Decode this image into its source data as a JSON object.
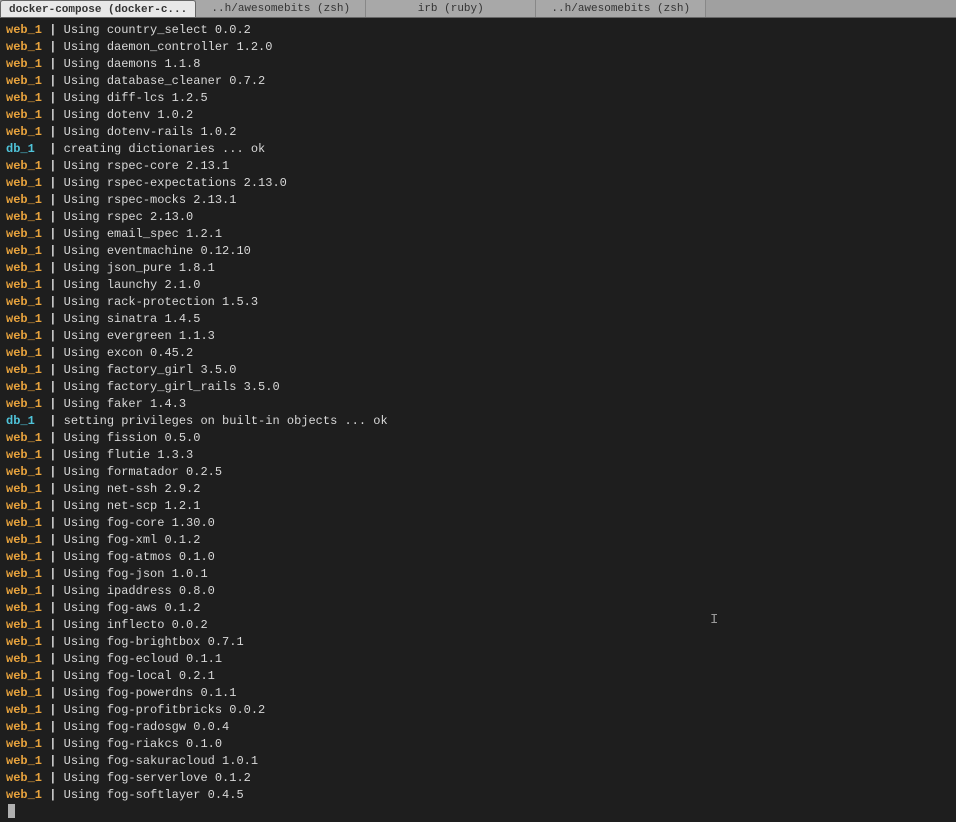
{
  "tabs": [
    {
      "label": "docker-compose (docker-c...",
      "active": true
    },
    {
      "label": "..h/awesomebits (zsh)",
      "active": false
    },
    {
      "label": "irb (ruby)",
      "active": false
    },
    {
      "label": "..h/awesomebits (zsh)",
      "active": false
    }
  ],
  "lines": [
    {
      "prefix": "web_1",
      "type": "web",
      "text": "Using country_select 0.0.2"
    },
    {
      "prefix": "web_1",
      "type": "web",
      "text": "Using daemon_controller 1.2.0"
    },
    {
      "prefix": "web_1",
      "type": "web",
      "text": "Using daemons 1.1.8"
    },
    {
      "prefix": "web_1",
      "type": "web",
      "text": "Using database_cleaner 0.7.2"
    },
    {
      "prefix": "web_1",
      "type": "web",
      "text": "Using diff-lcs 1.2.5"
    },
    {
      "prefix": "web_1",
      "type": "web",
      "text": "Using dotenv 1.0.2"
    },
    {
      "prefix": "web_1",
      "type": "web",
      "text": "Using dotenv-rails 1.0.2"
    },
    {
      "prefix": "db_1 ",
      "type": "db",
      "text": "creating dictionaries ... ok"
    },
    {
      "prefix": "web_1",
      "type": "web",
      "text": "Using rspec-core 2.13.1"
    },
    {
      "prefix": "web_1",
      "type": "web",
      "text": "Using rspec-expectations 2.13.0"
    },
    {
      "prefix": "web_1",
      "type": "web",
      "text": "Using rspec-mocks 2.13.1"
    },
    {
      "prefix": "web_1",
      "type": "web",
      "text": "Using rspec 2.13.0"
    },
    {
      "prefix": "web_1",
      "type": "web",
      "text": "Using email_spec 1.2.1"
    },
    {
      "prefix": "web_1",
      "type": "web",
      "text": "Using eventmachine 0.12.10"
    },
    {
      "prefix": "web_1",
      "type": "web",
      "text": "Using json_pure 1.8.1"
    },
    {
      "prefix": "web_1",
      "type": "web",
      "text": "Using launchy 2.1.0"
    },
    {
      "prefix": "web_1",
      "type": "web",
      "text": "Using rack-protection 1.5.3"
    },
    {
      "prefix": "web_1",
      "type": "web",
      "text": "Using sinatra 1.4.5"
    },
    {
      "prefix": "web_1",
      "type": "web",
      "text": "Using evergreen 1.1.3"
    },
    {
      "prefix": "web_1",
      "type": "web",
      "text": "Using excon 0.45.2"
    },
    {
      "prefix": "web_1",
      "type": "web",
      "text": "Using factory_girl 3.5.0"
    },
    {
      "prefix": "web_1",
      "type": "web",
      "text": "Using factory_girl_rails 3.5.0"
    },
    {
      "prefix": "web_1",
      "type": "web",
      "text": "Using faker 1.4.3"
    },
    {
      "prefix": "db_1 ",
      "type": "db",
      "text": "setting privileges on built-in objects ... ok"
    },
    {
      "prefix": "web_1",
      "type": "web",
      "text": "Using fission 0.5.0"
    },
    {
      "prefix": "web_1",
      "type": "web",
      "text": "Using flutie 1.3.3"
    },
    {
      "prefix": "web_1",
      "type": "web",
      "text": "Using formatador 0.2.5"
    },
    {
      "prefix": "web_1",
      "type": "web",
      "text": "Using net-ssh 2.9.2"
    },
    {
      "prefix": "web_1",
      "type": "web",
      "text": "Using net-scp 1.2.1"
    },
    {
      "prefix": "web_1",
      "type": "web",
      "text": "Using fog-core 1.30.0"
    },
    {
      "prefix": "web_1",
      "type": "web",
      "text": "Using fog-xml 0.1.2"
    },
    {
      "prefix": "web_1",
      "type": "web",
      "text": "Using fog-atmos 0.1.0"
    },
    {
      "prefix": "web_1",
      "type": "web",
      "text": "Using fog-json 1.0.1"
    },
    {
      "prefix": "web_1",
      "type": "web",
      "text": "Using ipaddress 0.8.0"
    },
    {
      "prefix": "web_1",
      "type": "web",
      "text": "Using fog-aws 0.1.2"
    },
    {
      "prefix": "web_1",
      "type": "web",
      "text": "Using inflecto 0.0.2"
    },
    {
      "prefix": "web_1",
      "type": "web",
      "text": "Using fog-brightbox 0.7.1"
    },
    {
      "prefix": "web_1",
      "type": "web",
      "text": "Using fog-ecloud 0.1.1"
    },
    {
      "prefix": "web_1",
      "type": "web",
      "text": "Using fog-local 0.2.1"
    },
    {
      "prefix": "web_1",
      "type": "web",
      "text": "Using fog-powerdns 0.1.1"
    },
    {
      "prefix": "web_1",
      "type": "web",
      "text": "Using fog-profitbricks 0.0.2"
    },
    {
      "prefix": "web_1",
      "type": "web",
      "text": "Using fog-radosgw 0.0.4"
    },
    {
      "prefix": "web_1",
      "type": "web",
      "text": "Using fog-riakcs 0.1.0"
    },
    {
      "prefix": "web_1",
      "type": "web",
      "text": "Using fog-sakuracloud 1.0.1"
    },
    {
      "prefix": "web_1",
      "type": "web",
      "text": "Using fog-serverlove 0.1.2"
    },
    {
      "prefix": "web_1",
      "type": "web",
      "text": "Using fog-softlayer 0.4.5"
    }
  ],
  "separator": " | "
}
